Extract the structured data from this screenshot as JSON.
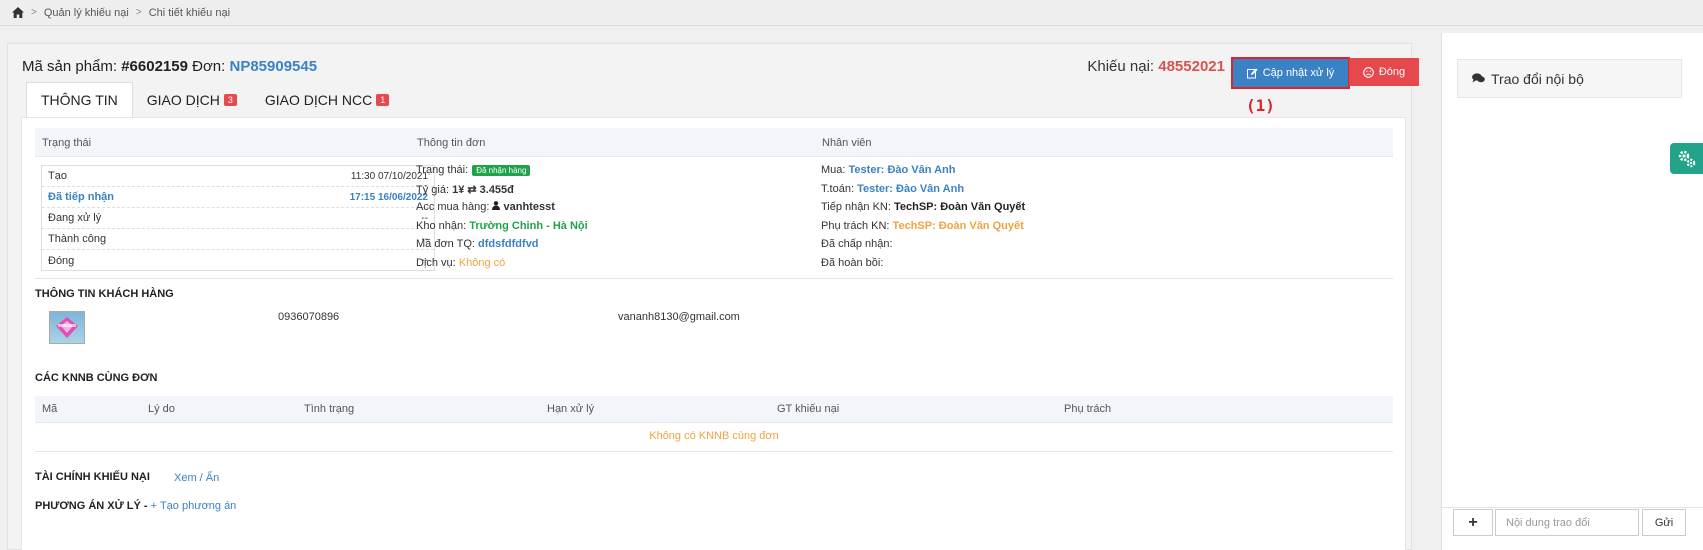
{
  "breadcrumb": {
    "item1": "Quản lý khiếu nại",
    "item2": "Chi tiết khiếu nại"
  },
  "header": {
    "product_label": "Mã sản phẩm:",
    "product_code": "#6602159",
    "order_label": "Đơn:",
    "order_code": "NP85909545",
    "complaint_label": "Khiếu nại:",
    "complaint_code": "48552021",
    "update_button": "Cập nhật xử lý",
    "close_button": "Đóng",
    "annotation": "(1)"
  },
  "tabs": [
    {
      "label": "THÔNG TIN"
    },
    {
      "label": "GIAO DỊCH",
      "badge": "3"
    },
    {
      "label": "GIAO DỊCH NCC",
      "badge": "1"
    }
  ],
  "info_table": {
    "col_status": "Trạng thái",
    "col_order": "Thông tin đơn",
    "col_staff": "Nhân viên",
    "status_rows": [
      {
        "label": "Tạo",
        "time": "11:30 07/10/2021"
      },
      {
        "label": "Đã tiếp nhận",
        "time": "17:15 16/06/2022"
      },
      {
        "label": "Đang xử lý",
        "time": "--"
      },
      {
        "label": "Thành công",
        "time": "--"
      },
      {
        "label": "Đóng",
        "time": "--"
      }
    ],
    "order_info": {
      "status_label": "Trạng thái:",
      "status_value": "Đã nhận hàng",
      "rate_label": "Tỷ giá:",
      "rate_value": "1¥ ⇄ 3.455đ",
      "acc_label": "Acc mua hàng:",
      "acc_value": "vanhtesst",
      "warehouse_label": "Kho nhận:",
      "warehouse_value": "Trường Chinh - Hà Nội",
      "tq_label": "Mã đơn TQ:",
      "tq_value": "dfdsfdfdfvd",
      "service_label": "Dịch vụ:",
      "service_value": "Không có"
    },
    "staff": {
      "buy_label": "Mua:",
      "buy_value": "Tester: Đào Vân Anh",
      "pay_label": "T.toán:",
      "pay_value": "Tester: Đào Vân Anh",
      "receive_label": "Tiếp nhận KN:",
      "receive_value": "TechSP: Đoàn Văn Quyết",
      "charge_label": "Phụ trách KN:",
      "charge_value": "TechSP: Đoàn Văn Quyết",
      "accepted_label": "Đã chấp nhận:",
      "refunded_label": "Đã hoàn bồi:"
    }
  },
  "customer": {
    "title": "THÔNG TIN KHÁCH HÀNG",
    "phone": "0936070896",
    "email": "vananh8130@gmail.com"
  },
  "knnb": {
    "title": "CÁC KNNB CÙNG ĐƠN",
    "columns": [
      "Mã",
      "Lý do",
      "Tình trạng",
      "Hạn xử lý",
      "GT khiếu nại",
      "Phụ trách"
    ],
    "empty": "Không có KNNB cùng đơn"
  },
  "finance": {
    "title": "TÀI CHÍNH KHIẾU NẠI",
    "toggle": "Xem / Ẩn"
  },
  "plan": {
    "title": "PHƯƠNG ÁN XỬ LÝ -",
    "create": "Tạo phương án"
  },
  "chat": {
    "title": "Trao đổi nội bộ",
    "add": "+",
    "placeholder": "Nội dung trao đổi",
    "send": "Gửi"
  },
  "colors": {
    "blue": "#3b82c4",
    "red": "#e5484d",
    "orange": "#f0a340",
    "green": "#1fa34a",
    "teal": "#22a38a"
  },
  "icons": [
    "home-icon",
    "edit-icon",
    "frown-icon",
    "comments-icon",
    "gear-icon",
    "user-icon"
  ]
}
